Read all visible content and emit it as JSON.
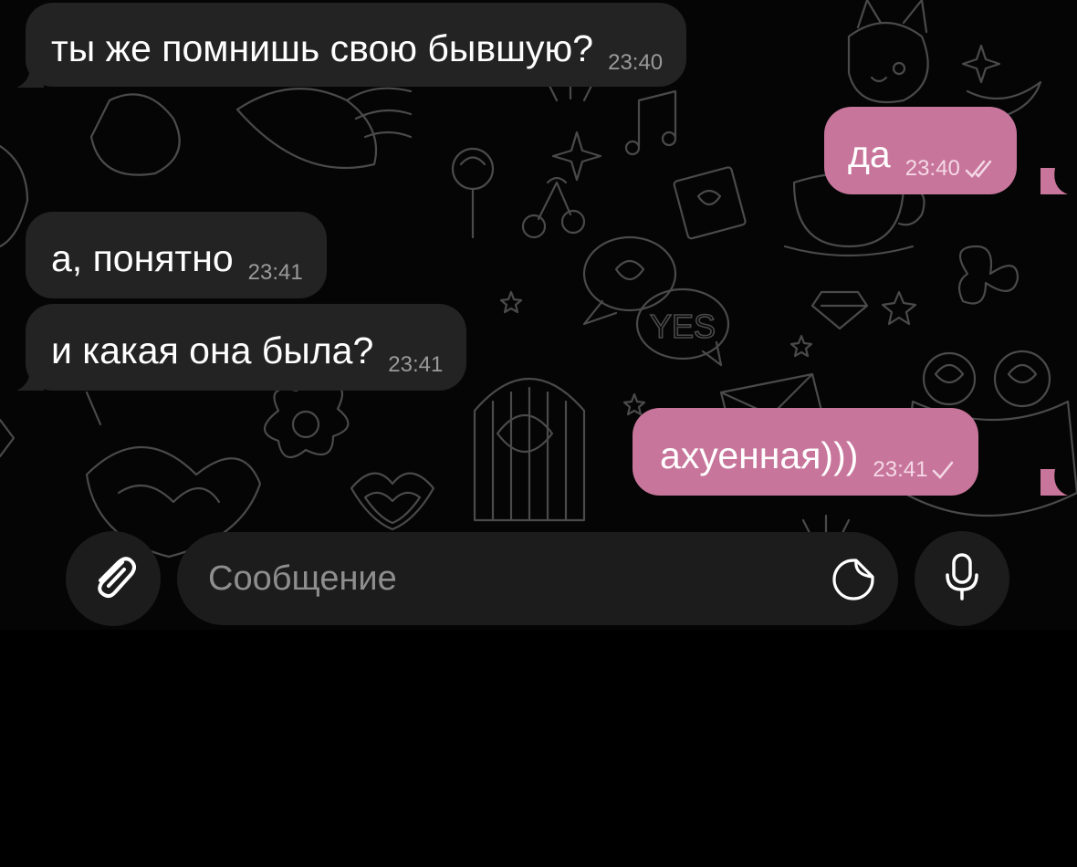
{
  "chat": {
    "messages": [
      {
        "direction": "incoming",
        "text": "ты же помнишь свою бывшую?",
        "time": "23:40"
      },
      {
        "direction": "outgoing",
        "text": "да",
        "time": "23:40",
        "status": "read"
      },
      {
        "direction": "incoming",
        "text": "а, понятно",
        "time": "23:41"
      },
      {
        "direction": "incoming",
        "text": "и какая она была?",
        "time": "23:41"
      },
      {
        "direction": "outgoing",
        "text": "ахуенная)))",
        "time": "23:41",
        "status": "sent"
      }
    ],
    "background_doodle_text": "YES"
  },
  "composer": {
    "placeholder": "Сообщение",
    "attach_icon": "paperclip-icon",
    "sticker_icon": "sticker-icon",
    "mic_icon": "microphone-icon"
  },
  "colors": {
    "incoming_bubble": "#232323",
    "outgoing_bubble": "#c8759b",
    "background": "#050505"
  }
}
